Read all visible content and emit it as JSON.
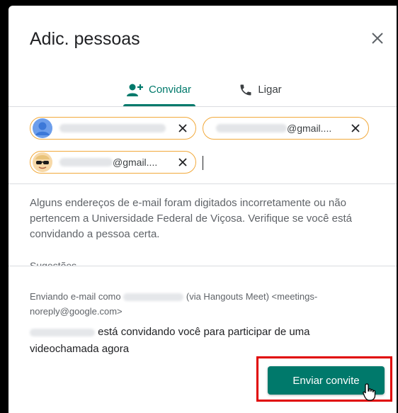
{
  "dialog": {
    "title": "Adic. pessoas",
    "close_icon": "close-icon"
  },
  "tabs": [
    {
      "label": "Convidar",
      "icon": "person-add-icon",
      "active": true
    },
    {
      "label": "Ligar",
      "icon": "phone-icon",
      "active": false
    }
  ],
  "chips": [
    {
      "avatar": "blue-default-avatar",
      "suffix": ""
    },
    {
      "avatar": "none",
      "suffix": "@gmail...."
    },
    {
      "avatar": "sunglasses-avatar",
      "suffix": "@gmail...."
    }
  ],
  "warning_text": "Alguns endereços de e-mail foram digitados incorretamente ou não pertencem a Universidade Federal de Viçosa. Verifique se você está convidando a pessoa certa.",
  "suggestions_label": "Sugestões",
  "footer": {
    "sending_prefix": "Enviando e-mail como",
    "sending_suffix": "(via Hangouts Meet) <meetings-noreply@google.com>",
    "invite_message": "está convidando você para participar de uma videochamada agora"
  },
  "send_button_label": "Enviar convite",
  "colors": {
    "accent": "#00796b",
    "chip_border": "#f2a93b",
    "highlight": "#e00000"
  }
}
